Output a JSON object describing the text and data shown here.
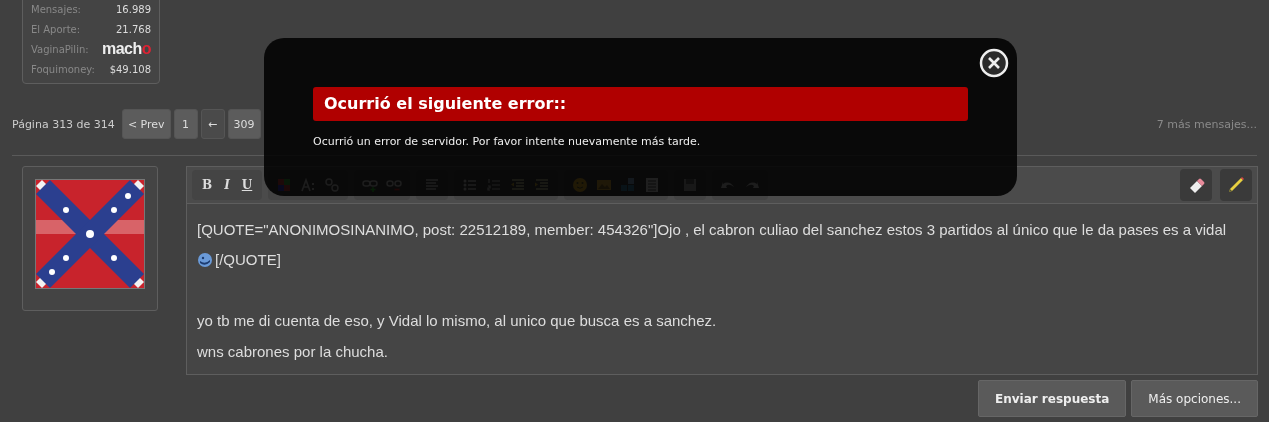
{
  "user_stats": [
    {
      "label": "Mensajes:",
      "value": "16.989",
      "kind": "text"
    },
    {
      "label": "El Aporte:",
      "value": "21.768",
      "kind": "text"
    },
    {
      "label": "VaginaPilin:",
      "value": "macho",
      "kind": "rank"
    },
    {
      "label": "Foquimoney:",
      "value": "$49.108",
      "kind": "text"
    }
  ],
  "pagination": {
    "summary": "Página 313 de 314",
    "buttons": [
      {
        "label": "< Prev",
        "kind": "nav"
      },
      {
        "label": "1",
        "kind": "page"
      },
      {
        "label": "←",
        "kind": "jump"
      },
      {
        "label": "309",
        "kind": "page"
      }
    ],
    "more": "7 más mensajes..."
  },
  "editor": {
    "format_buttons": [
      "B",
      "I",
      "U"
    ],
    "lines": [
      {
        "text": "[QUOTE=\"ANONIMOSINANIMO, post: 22512189, member: 454326\"]Ojo , el cabron culiao del sanchez estos 3 partidos al único que le da pases es a vidal",
        "smiley": false
      },
      {
        "text": "[/QUOTE]",
        "smiley": true
      },
      {
        "smiley": false
      },
      {
        "text": "yo tb me di cuenta de eso, y Vidal lo mismo, al unico que busca es a sanchez.",
        "smiley": false
      },
      {
        "text": "wns cabrones por la chucha.",
        "smiley": false
      }
    ]
  },
  "actions": [
    "Enviar respuesta",
    "Más opciones..."
  ],
  "error_dialog": {
    "title": "Ocurrió el siguiente error::",
    "message": "Ocurrió un error de servidor. Por favor intente nuevamente más tarde."
  }
}
